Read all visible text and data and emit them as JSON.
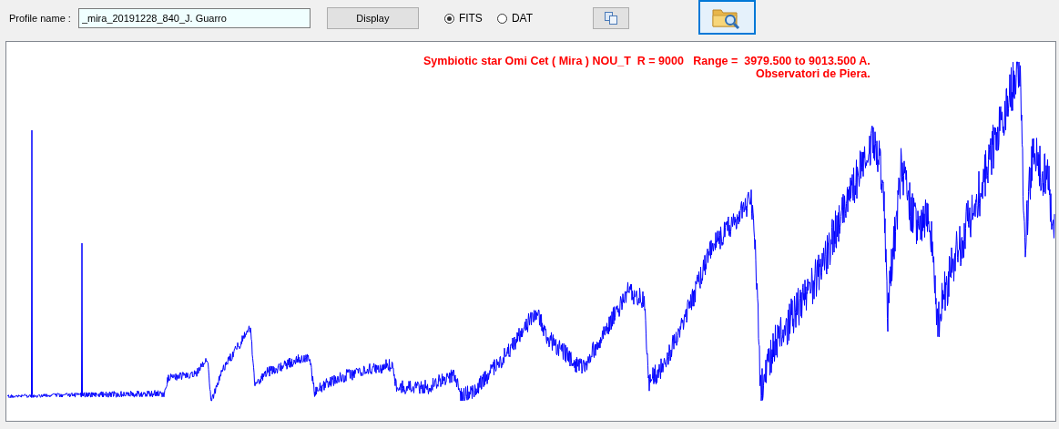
{
  "toolbar": {
    "profile_label": "Profile name :",
    "profile_value": "_mira_20191228_840_J. Guarro",
    "display_button": "Display",
    "formats": [
      {
        "label": "FITS",
        "selected": true
      },
      {
        "label": "DAT",
        "selected": false
      }
    ]
  },
  "plot": {
    "caption": [
      "Symbiotic star Omi Cet ( Mira ) NOU_T  R = 9000   Range =  3979.500 to 9013.500 A.",
      "Observatori de Piera."
    ]
  }
}
